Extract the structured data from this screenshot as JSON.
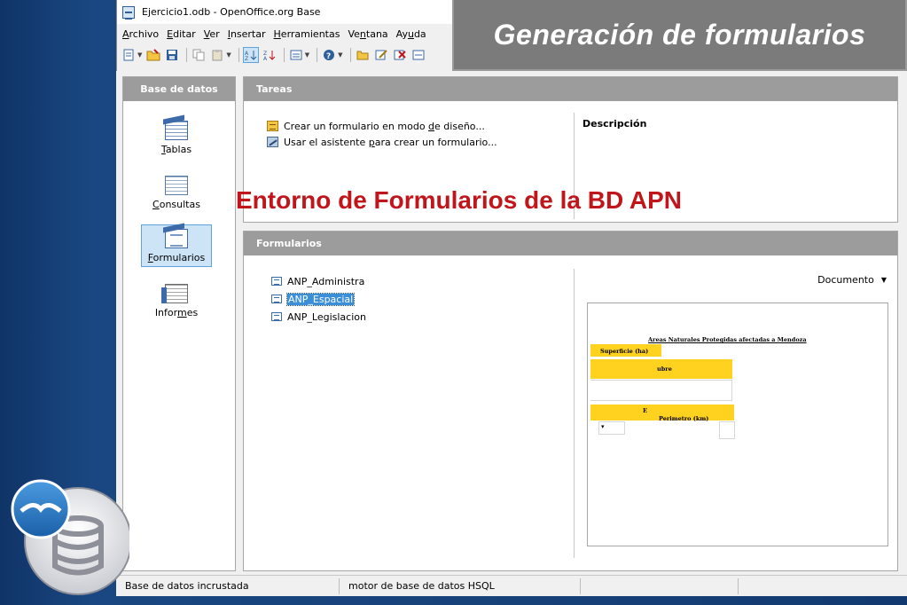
{
  "window": {
    "title": "Ejercicio1.odb - OpenOffice.org Base"
  },
  "menu": [
    {
      "before": "",
      "key": "A",
      "after": "rchivo"
    },
    {
      "before": "",
      "key": "E",
      "after": "ditar"
    },
    {
      "before": "",
      "key": "V",
      "after": "er"
    },
    {
      "before": "",
      "key": "I",
      "after": "nsertar"
    },
    {
      "before": "",
      "key": "H",
      "after": "erramientas"
    },
    {
      "before": "Ve",
      "key": "n",
      "after": "tana"
    },
    {
      "before": "Ay",
      "key": "u",
      "after": "da"
    }
  ],
  "slide": {
    "title": "Generación de formularios",
    "caption": "Entorno de Formularios de la BD APN"
  },
  "sidebar": {
    "header": "Base de datos",
    "items": [
      {
        "before": "",
        "key": "T",
        "after": "ablas",
        "icon": "table-icon"
      },
      {
        "before": "",
        "key": "C",
        "after": "onsultas",
        "icon": "query-icon"
      },
      {
        "before": "",
        "key": "F",
        "after": "ormularios",
        "icon": "form-icon"
      },
      {
        "before": "Infor",
        "key": "m",
        "after": "es",
        "icon": "report-icon"
      }
    ]
  },
  "tasks": {
    "header": "Tareas",
    "items": [
      {
        "before": "Crear un formulario en modo ",
        "key": "d",
        "after": "e diseño..."
      },
      {
        "before": "Usar el asistente ",
        "key": "p",
        "after": "ara crear un formulario..."
      }
    ],
    "description_label": "Descripción"
  },
  "forms": {
    "header": "Formularios",
    "items": [
      "ANP_Administra",
      "ANP_Espacial",
      "ANP_Legislacion"
    ],
    "selected_index": 1,
    "view_dropdown": "Documento"
  },
  "preview": {
    "title": "Areas Naturales Protegidas afectadas a Mendoza",
    "label_superficie": "Superficie (ha)",
    "label_nombre": "ubre",
    "label_e": "E",
    "label_perimetro": "Perimetro (km)"
  },
  "status": {
    "left": "Base de datos incrustada",
    "right": "motor de base de datos HSQL"
  },
  "colors": {
    "slide_background": "#123a70",
    "caption_red": "#c0151b",
    "panel_header_gray": "#9c9c9c",
    "selection_blue": "#3b8fd9",
    "preview_yellow": "#ffd21f"
  }
}
